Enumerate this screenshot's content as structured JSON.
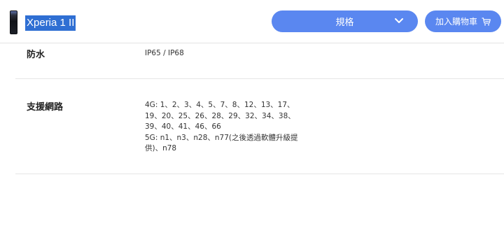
{
  "header": {
    "product_name": "Xperia 1 II",
    "spec_button_label": "規格",
    "cart_button_label": "加入購物車"
  },
  "specs": {
    "waterproof": {
      "label": "防水",
      "value": "IP65 / IP68"
    },
    "network": {
      "label": "支援網路",
      "lines": [
        "4G: 1、2、3、4、5、7、8、12、13、17、",
        "19、20、25、26、28、29、32、34、38、",
        "39、40、41、46、66",
        "5G: n1、n3、n28、n77(之後透過軟體升級提",
        "供)、n78"
      ]
    }
  },
  "icons": {
    "spec_dropdown": "chevron-down-icon",
    "cart": "cart-icon"
  },
  "colors": {
    "button_bg": "#5a87f0",
    "selection_highlight": "#2f6fd3"
  }
}
